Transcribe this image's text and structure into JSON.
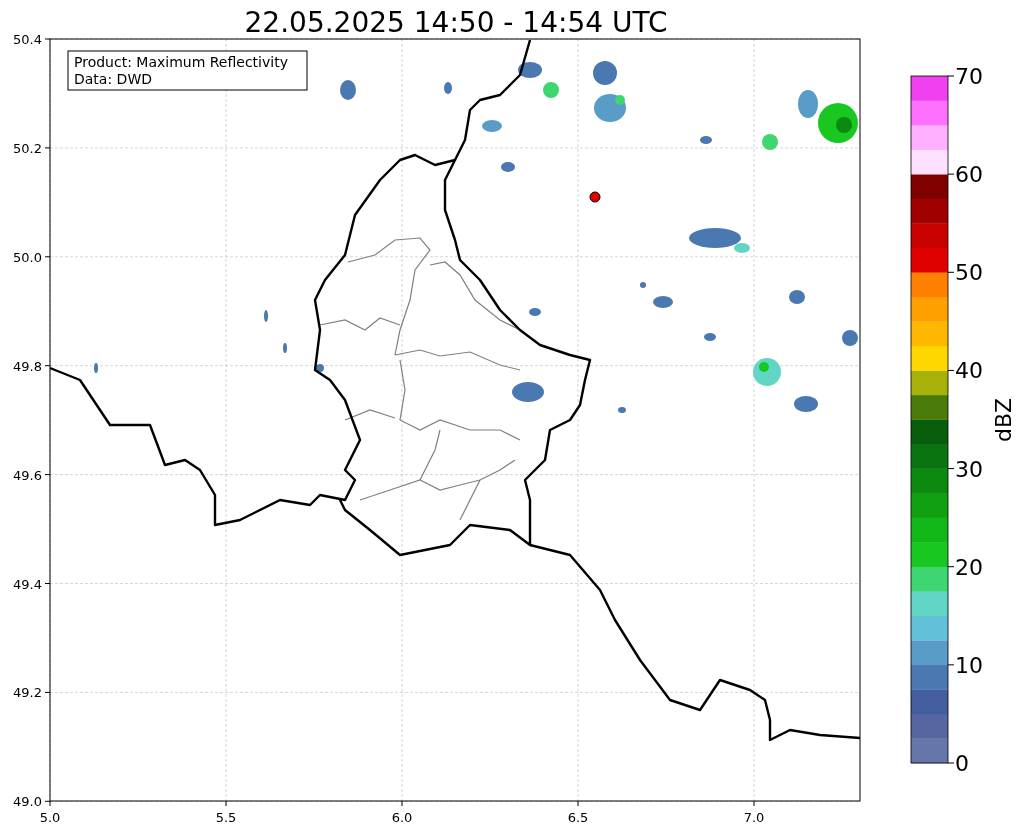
{
  "title": "22.05.2025 14:50 - 14:54 UTC",
  "legend": [
    "Product: Maximum Reflectivity",
    "Data: DWD"
  ],
  "x_ticks": [
    "5.0",
    "5.5",
    "6.0",
    "6.5",
    "7.0"
  ],
  "y_ticks": [
    "50.4",
    "50.2",
    "50.0",
    "49.8",
    "49.6",
    "49.4",
    "49.2",
    "49.0"
  ],
  "colorbar": {
    "label": "dBZ",
    "ticks": [
      "70",
      "60",
      "50",
      "40",
      "30",
      "20",
      "10",
      "0"
    ],
    "bins": [
      {
        "color": "#6577a8"
      },
      {
        "color": "#5566a0"
      },
      {
        "color": "#445f9f"
      },
      {
        "color": "#4a78b0"
      },
      {
        "color": "#5a9cc8"
      },
      {
        "color": "#62c0d8"
      },
      {
        "color": "#62d6c6"
      },
      {
        "color": "#3ed670"
      },
      {
        "color": "#18c820"
      },
      {
        "color": "#12b818"
      },
      {
        "color": "#10a012"
      },
      {
        "color": "#0c8a10"
      },
      {
        "color": "#0a7510"
      },
      {
        "color": "#085e0c"
      },
      {
        "color": "#4a7a0a"
      },
      {
        "color": "#a8b00a"
      },
      {
        "color": "#ffd700"
      },
      {
        "color": "#ffb800"
      },
      {
        "color": "#ffa000"
      },
      {
        "color": "#ff8000"
      },
      {
        "color": "#e00000"
      },
      {
        "color": "#c80000"
      },
      {
        "color": "#a00000"
      },
      {
        "color": "#800000"
      },
      {
        "color": "#ffe0ff"
      },
      {
        "color": "#ffb0ff"
      },
      {
        "color": "#ff70ff"
      },
      {
        "color": "#f040f0"
      }
    ]
  }
}
